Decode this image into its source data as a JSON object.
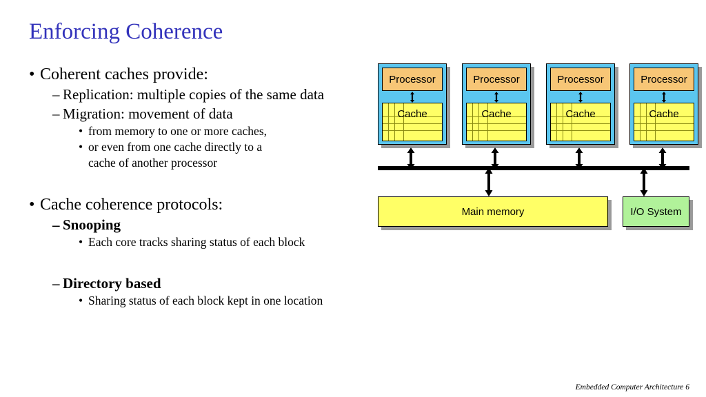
{
  "slide": {
    "title": "Enforcing Coherence",
    "title_color": "#3333bb",
    "footer": "Embedded Computer Architecture  6"
  },
  "content": {
    "bullet1": {
      "text": "Coherent caches provide:",
      "children": [
        {
          "text": "Replication:  multiple copies of the same data"
        },
        {
          "text": "Migration:    movement of data"
        }
      ],
      "subchildren": [
        {
          "text": "from memory to one or more caches,"
        },
        {
          "text": "or even from one cache directly to a"
        },
        {
          "text": "cache of another processor"
        }
      ]
    },
    "bullet2": {
      "text": "Cache coherence protocols:",
      "snooping_label": "Snooping",
      "snooping_detail": "Each core tracks sharing status of each block",
      "directory_label": "Directory based",
      "directory_detail": "Sharing status of each block kept in one location"
    },
    "marks": {
      "dash": "–",
      "dot": "•"
    }
  },
  "diagram": {
    "units": [
      {
        "processor_label": "Processor",
        "cache_label": "Cache"
      },
      {
        "processor_label": "Processor",
        "cache_label": "Cache"
      },
      {
        "processor_label": "Processor",
        "cache_label": "Cache"
      },
      {
        "processor_label": "Processor",
        "cache_label": "Cache"
      }
    ],
    "main_memory_label": "Main memory",
    "io_system_label": "I/O System",
    "colors": {
      "unit_frame": "#5bc6ef",
      "processor_fill": "#f7c676",
      "cache_fill": "#ffff66",
      "cache_gridline": "#8a8a10",
      "main_memory_fill": "#ffff66",
      "io_system_fill": "#b1f29a",
      "bus": "#000000",
      "shadow": "#9a9a9a"
    }
  }
}
